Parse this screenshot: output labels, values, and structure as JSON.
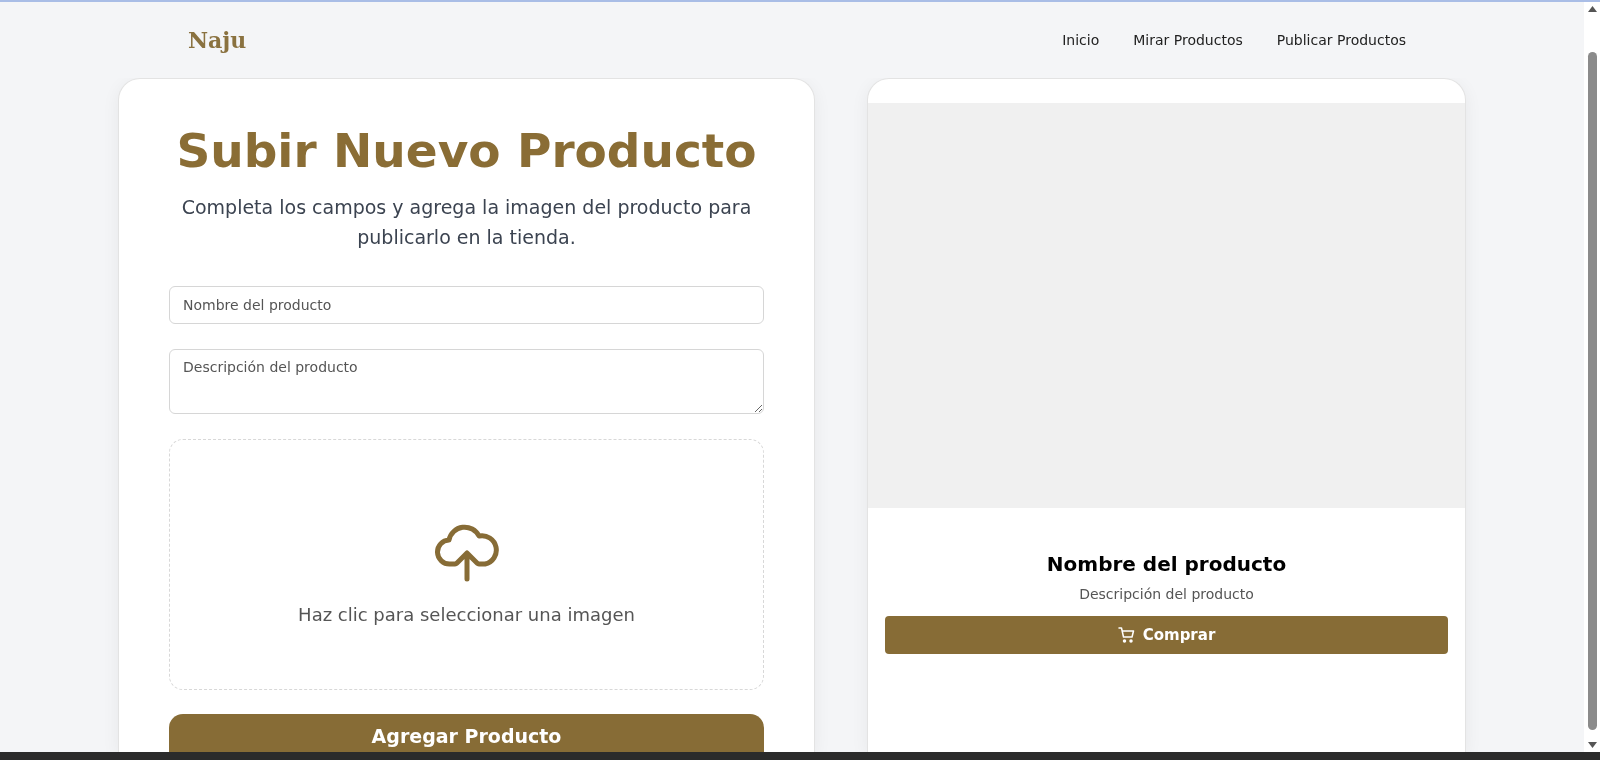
{
  "navbar": {
    "brand": "Naju",
    "links": [
      {
        "label": "Inicio"
      },
      {
        "label": "Mirar Productos"
      },
      {
        "label": "Publicar Productos"
      }
    ]
  },
  "form": {
    "title": "Subir Nuevo Producto",
    "subtitle": "Completa los campos y agrega la imagen del producto para publicarlo en la tienda.",
    "name_field": {
      "placeholder": "Nombre del producto"
    },
    "description_field": {
      "placeholder": "Descripción del producto"
    },
    "upload": {
      "label": "Haz clic para seleccionar una imagen"
    },
    "submit": "Agregar Producto"
  },
  "preview": {
    "title": "Nombre del producto",
    "description": "Descripción del producto",
    "buy_button": "Comprar"
  }
}
